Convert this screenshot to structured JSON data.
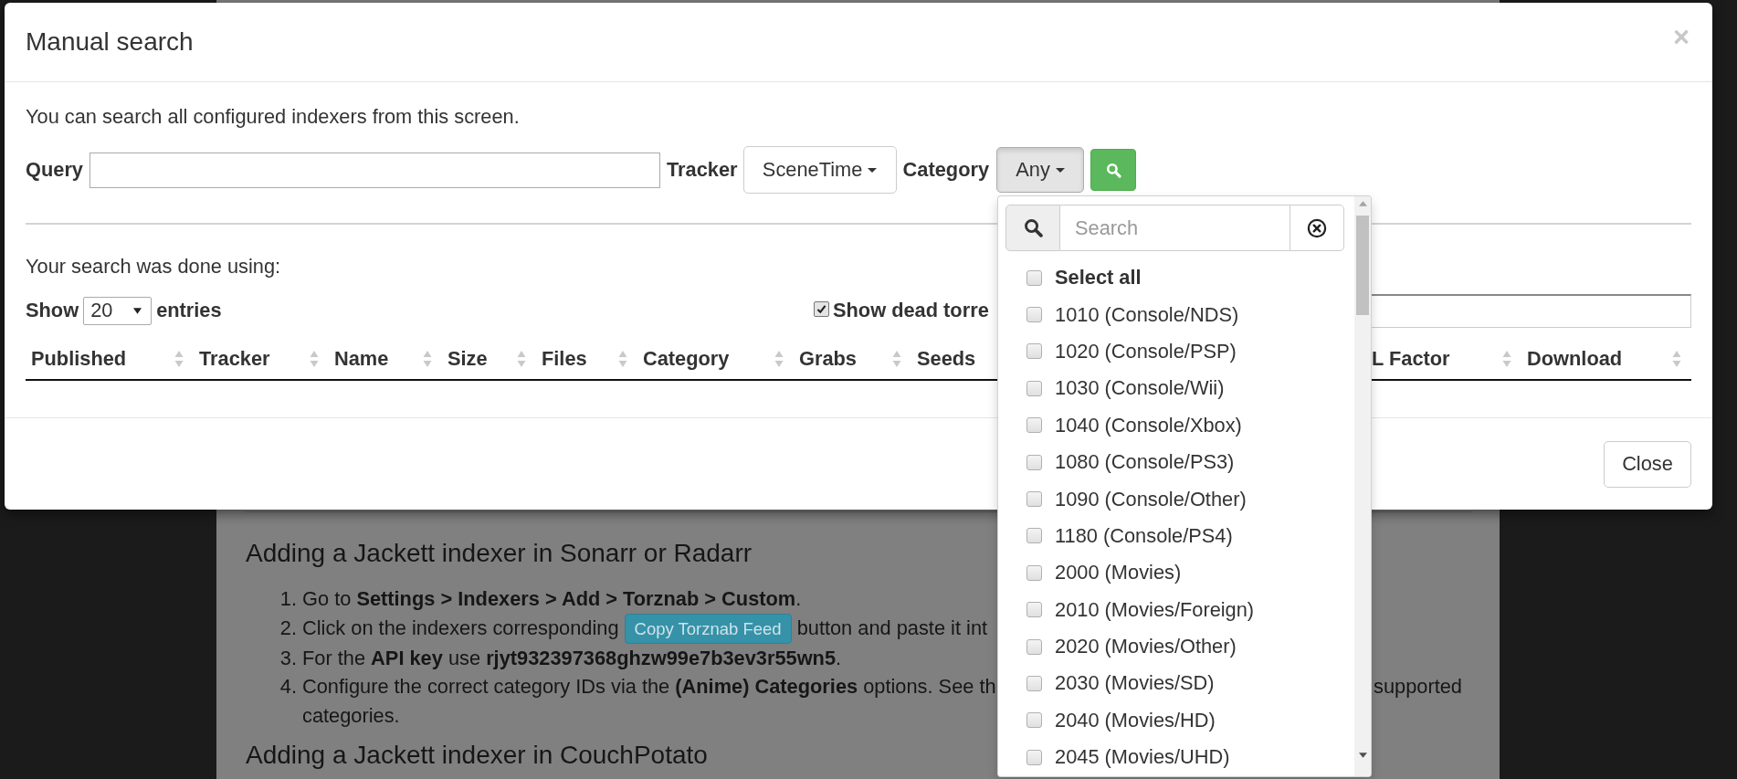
{
  "background_page": {
    "sections": [
      {
        "heading": "Adding a Jackett indexer in Sonarr or Radarr",
        "steps": [
          {
            "number": "1.",
            "text": "Go to **Settings > Indexers > Add > Torznab > Custom**."
          },
          {
            "number": "2.",
            "text": "Click on the indexers corresponding",
            "button": "Copy Torznab Feed",
            "after": "button and paste it int"
          },
          {
            "number": "3.",
            "text": "For the **API key** use **rjyt932397368ghzw99e7b3ev3r55wn5**."
          },
          {
            "number": "4.",
            "text": "Configure the correct category IDs via the **(Anime) Categories** options. See th",
            "right_text": "supported",
            "continuation": "categories."
          }
        ]
      },
      {
        "heading": "Adding a Jackett indexer in CouchPotato"
      }
    ]
  },
  "modal": {
    "title": "Manual search",
    "close": "×",
    "intro": "You can search all configured indexers from this screen.",
    "query": {
      "label": "Query"
    },
    "tracker": {
      "label": "Tracker",
      "value": "SceneTime"
    },
    "category": {
      "label": "Category",
      "value": "Any",
      "expanded": true
    },
    "results_note": "Your search was done using:",
    "page_length": {
      "prefix": "Show",
      "value": "20",
      "suffix": "entries"
    },
    "dead_torrents": {
      "label": "Show dead torre",
      "checked": true
    },
    "table": {
      "columns": [
        {
          "label": "Published",
          "sort_arrows": true
        },
        {
          "label": "Tracker",
          "sort_arrows": true
        },
        {
          "label": "Name",
          "sort_arrows": true
        },
        {
          "label": "Size",
          "sort_arrows": true
        },
        {
          "label": "Files",
          "sort_arrows": true
        },
        {
          "label": "Category",
          "sort_arrows": true
        },
        {
          "label": "Grabs",
          "sort_arrows": true
        },
        {
          "label": "Seeds",
          "sort_arrows": false
        },
        {
          "label": "L Factor",
          "sort_arrows": true
        },
        {
          "label": "Download",
          "sort_arrows": true
        }
      ]
    },
    "footer_button": "Close"
  },
  "category_dropdown": {
    "search_placeholder": "Search",
    "items": [
      {
        "label": "Select all",
        "kind": "all",
        "checked": false
      },
      {
        "label": "1010 (Console/NDS)",
        "kind": "option",
        "checked": false
      },
      {
        "label": "1020 (Console/PSP)",
        "kind": "option",
        "checked": false
      },
      {
        "label": "1030 (Console/Wii)",
        "kind": "option",
        "checked": false
      },
      {
        "label": "1040 (Console/Xbox)",
        "kind": "option",
        "checked": false
      },
      {
        "label": "1080 (Console/PS3)",
        "kind": "option",
        "checked": false
      },
      {
        "label": "1090 (Console/Other)",
        "kind": "option",
        "checked": false
      },
      {
        "label": "1180 (Console/PS4)",
        "kind": "option",
        "checked": false
      },
      {
        "label": "2000 (Movies)",
        "kind": "option",
        "checked": false
      },
      {
        "label": "2010 (Movies/Foreign)",
        "kind": "option",
        "checked": false
      },
      {
        "label": "2020 (Movies/Other)",
        "kind": "option",
        "checked": false
      },
      {
        "label": "2030 (Movies/SD)",
        "kind": "option",
        "checked": false
      },
      {
        "label": "2040 (Movies/HD)",
        "kind": "option",
        "checked": false
      },
      {
        "label": "2045 (Movies/UHD)",
        "kind": "option",
        "checked": false
      }
    ]
  }
}
